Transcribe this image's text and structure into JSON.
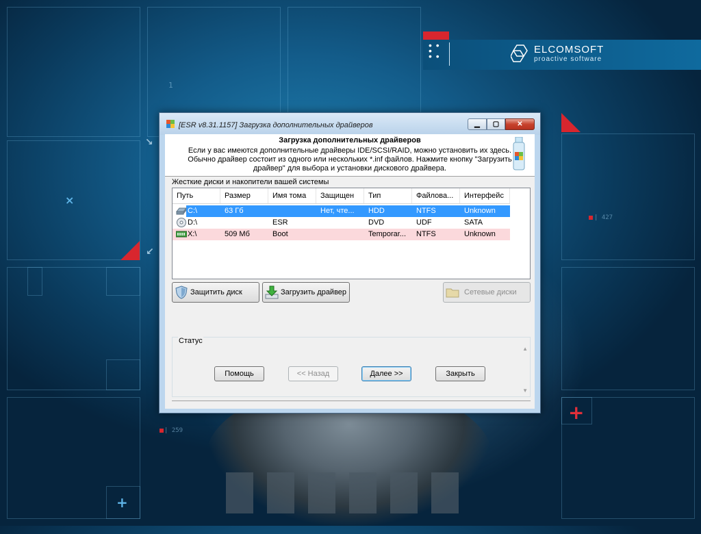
{
  "background": {
    "marks": [
      "1",
      "| 427",
      "| 259"
    ],
    "brand": {
      "name": "ELCOMSOFT",
      "tagline": "proactive software"
    }
  },
  "window": {
    "title": "[ESR v8.31.1157]  Загрузка дополнительных драйверов",
    "controls": {
      "minimize": "▁",
      "maximize": "▢",
      "close": "✕"
    }
  },
  "dialog": {
    "heading": "Загрузка дополнительных драйверов",
    "description_line1": "Если у вас имеются дополнительные драйверы IDE/SCSI/RAID, можно установить их здесь.",
    "description_line2": "Обычно драйвер состоит из одного или нескольких *.inf файлов. Нажмите кнопку \"Загрузить",
    "description_line3": "драйвер\" для выбора и установки дискового драйвера."
  },
  "disks": {
    "label": "Жесткие диски и накопители вашей системы",
    "columns": [
      "Путь",
      "Размер",
      "Имя тома",
      "Защищен",
      "Тип",
      "Файлова...",
      "Интерфейс"
    ],
    "rows": [
      {
        "path": "C:\\",
        "size": "63 Гб",
        "volume": "",
        "protected": "Нет, чте...",
        "type": "HDD",
        "fs": "NTFS",
        "interface": "Unknown",
        "icon": "hard-disk-icon",
        "state": "selected"
      },
      {
        "path": "D:\\",
        "size": "",
        "volume": "ESR",
        "protected": "",
        "type": "DVD",
        "fs": "UDF",
        "interface": "SATA",
        "icon": "optical-disc-icon",
        "state": "normal"
      },
      {
        "path": "X:\\",
        "size": "509 Мб",
        "volume": "Boot",
        "protected": "",
        "type": "Temporar...",
        "fs": "NTFS",
        "interface": "Unknown",
        "icon": "ram-disk-icon",
        "state": "highlighted"
      }
    ]
  },
  "actions": {
    "protect": "Защитить диск",
    "load_driver": "Загрузить драйвер",
    "network": "Сетевые диски"
  },
  "status": {
    "label": "Статус",
    "text": ""
  },
  "nav": {
    "help": "Помощь",
    "back": "<< Назад",
    "next": "Далее >>",
    "close": "Закрыть"
  },
  "colors": {
    "selected_row": "#3399ff",
    "highlighted_row": "#fbd9dc",
    "accent_red": "#d8262e"
  }
}
